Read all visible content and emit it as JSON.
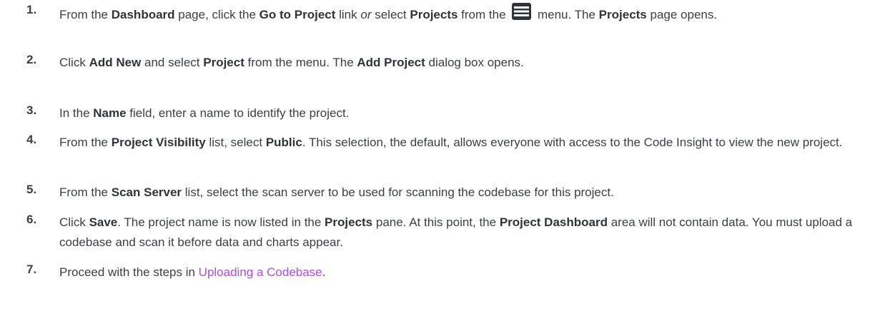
{
  "steps": [
    {
      "num": "1.",
      "parts": [
        {
          "t": "From the "
        },
        {
          "b": "Dashboard"
        },
        {
          "t": " page, click the "
        },
        {
          "b": "Go to Project"
        },
        {
          "t": " link "
        },
        {
          "i": "or"
        },
        {
          "t": " select "
        },
        {
          "b": "Projects"
        },
        {
          "t": " from the "
        },
        {
          "icon": "hamburger-menu-icon"
        },
        {
          "t": " menu. The "
        },
        {
          "b": "Projects"
        },
        {
          "t": " page opens."
        }
      ]
    },
    {
      "num": "2.",
      "parts": [
        {
          "t": "Click "
        },
        {
          "b": "Add New"
        },
        {
          "t": " and select "
        },
        {
          "b": "Project"
        },
        {
          "t": " from the menu. The "
        },
        {
          "b": "Add Project"
        },
        {
          "t": " dialog box opens."
        }
      ]
    },
    {
      "num": "3.",
      "parts": [
        {
          "t": "In the "
        },
        {
          "b": "Name"
        },
        {
          "t": " field, enter a name to identify the project."
        }
      ]
    },
    {
      "num": "4.",
      "parts": [
        {
          "t": "From the "
        },
        {
          "b": "Project Visibility"
        },
        {
          "t": " list, select "
        },
        {
          "b": "Public"
        },
        {
          "t": ". This selection, the default, allows everyone with access to the Code Insight to view the new project."
        }
      ]
    },
    {
      "num": "5.",
      "parts": [
        {
          "t": "From the "
        },
        {
          "b": "Scan Server"
        },
        {
          "t": " list, select the scan server to be used for scanning the codebase for this project."
        }
      ]
    },
    {
      "num": "6.",
      "parts": [
        {
          "t": "Click "
        },
        {
          "b": "Save"
        },
        {
          "t": ". The project name is now listed in the "
        },
        {
          "b": "Projects"
        },
        {
          "t": " pane. At this point, the "
        },
        {
          "b": "Project Dashboard"
        },
        {
          "t": " area will not contain data. You must upload a codebase and scan it before data and charts appear."
        }
      ]
    },
    {
      "num": "7.",
      "parts": [
        {
          "t": "Proceed with the steps in "
        },
        {
          "link": "Uploading a Codebase"
        },
        {
          "t": "."
        }
      ]
    }
  ],
  "colors": {
    "text": "#3a3f44",
    "link": "#b24be3",
    "icon": "#2f3438"
  }
}
